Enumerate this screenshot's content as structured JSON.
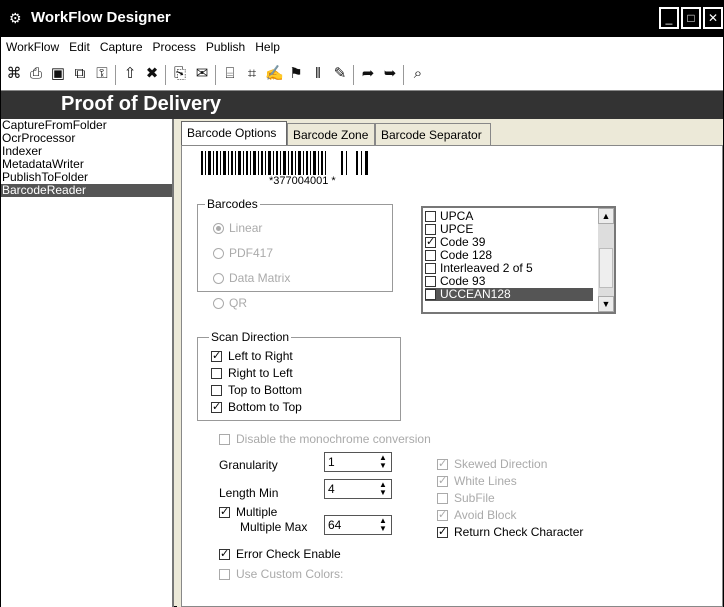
{
  "window": {
    "title": "WorkFlow Designer",
    "icon": "gear-icon"
  },
  "menu": [
    "WorkFlow",
    "Edit",
    "Capture",
    "Process",
    "Publish",
    "Help"
  ],
  "toolbar_icons": [
    "new-workflow-icon",
    "print-icon",
    "save-icon",
    "save-as-icon",
    "lock-icon",
    "up-arrow-icon",
    "delete-icon",
    "copy-icon",
    "mail-icon",
    "scan-icon",
    "ocr-icon",
    "signature-icon",
    "meta-icon",
    "barcode-icon",
    "pen-icon",
    "export-icon",
    "publish-icon",
    "preview-icon"
  ],
  "banner": {
    "title": "Proof of Delivery"
  },
  "sidebar": {
    "items": [
      "CaptureFromFolder",
      "OcrProcessor",
      "Indexer",
      "MetadataWriter",
      "PublishToFolder",
      "BarcodeReader"
    ],
    "selected": "BarcodeReader"
  },
  "tabs": [
    "Barcode Options",
    "Barcode Zone",
    "Barcode Separator"
  ],
  "barcode_sample": {
    "text": "*377004001 *"
  },
  "barcodes_group": {
    "label": "Barcodes",
    "options": [
      {
        "label": "Linear",
        "checked": true
      },
      {
        "label": "PDF417",
        "checked": false
      },
      {
        "label": "Data Matrix",
        "checked": false
      },
      {
        "label": "QR",
        "checked": false
      }
    ]
  },
  "barcode_types": [
    {
      "label": "UPCA",
      "checked": false
    },
    {
      "label": "UPCE",
      "checked": false
    },
    {
      "label": "Code 39",
      "checked": true
    },
    {
      "label": "Code 128",
      "checked": false
    },
    {
      "label": "Interleaved 2 of 5",
      "checked": false
    },
    {
      "label": "Code 93",
      "checked": false
    },
    {
      "label": "UCCEAN128",
      "checked": false,
      "selected": true
    }
  ],
  "scan_direction": {
    "label": "Scan Direction",
    "options": [
      {
        "label": "Left to Right",
        "checked": true
      },
      {
        "label": "Right to Left",
        "checked": false
      },
      {
        "label": "Top to Bottom",
        "checked": false
      },
      {
        "label": "Bottom to Top",
        "checked": true
      }
    ]
  },
  "disable_monochrome": {
    "label": "Disable the monochrome conversion",
    "checked": false
  },
  "granularity": {
    "label": "Granularity",
    "value": "1"
  },
  "length_min": {
    "label": "Length Min",
    "value": "4"
  },
  "multiple": {
    "label": "Multiple",
    "checked": true
  },
  "multiple_max": {
    "label": "Multiple Max",
    "value": "64"
  },
  "error_check": {
    "label": "Error Check Enable",
    "checked": true
  },
  "custom_colors": {
    "label": "Use Custom Colors:",
    "checked": false
  },
  "right_options": [
    {
      "label": "Skewed Direction",
      "checked": true,
      "disabled": true
    },
    {
      "label": "White Lines",
      "checked": true,
      "disabled": true
    },
    {
      "label": "SubFile",
      "checked": false,
      "disabled": true
    },
    {
      "label": "Avoid Block",
      "checked": true,
      "disabled": true
    },
    {
      "label": "Return Check Character",
      "checked": true,
      "disabled": false
    }
  ]
}
